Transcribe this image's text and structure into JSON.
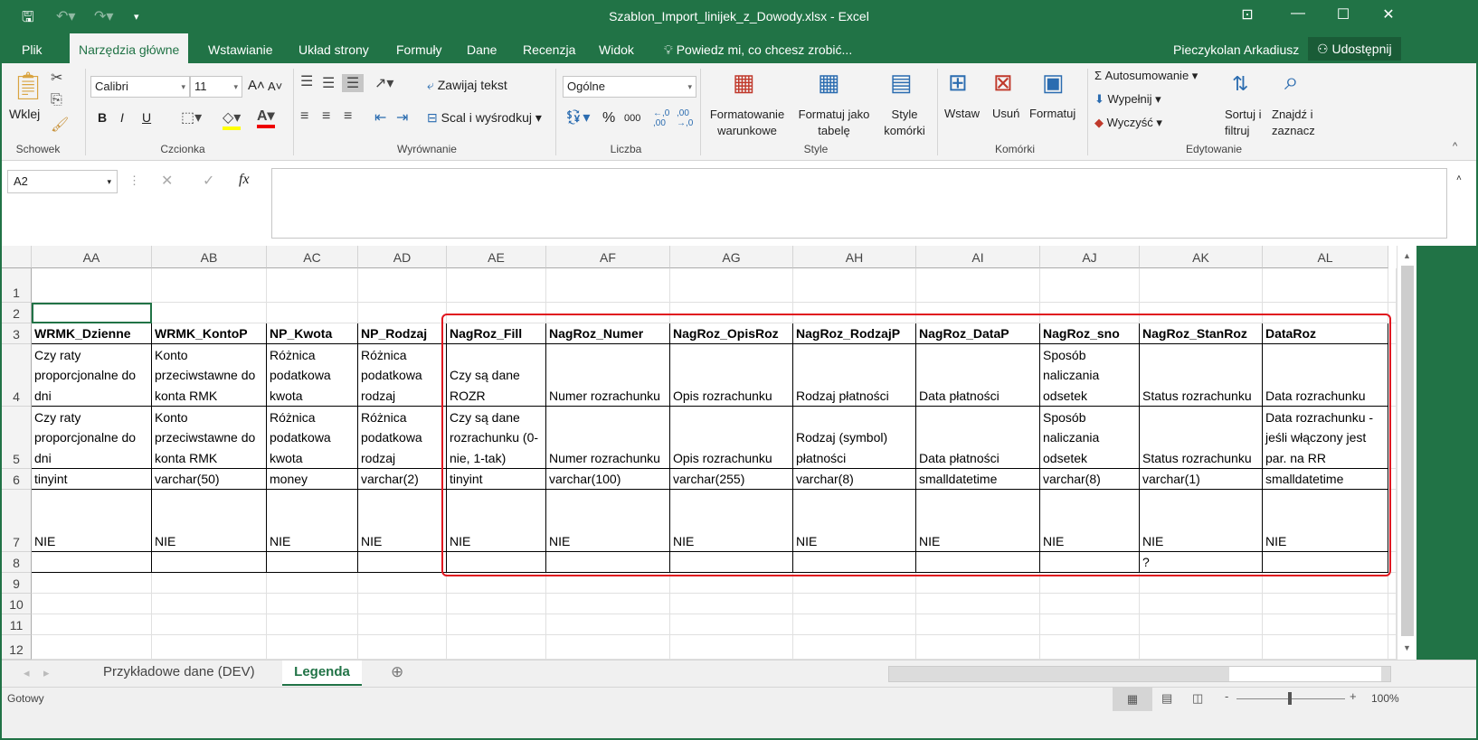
{
  "window": {
    "title": "Szablon_Import_linijek_z_Dowody.xlsx - Excel",
    "user": "Pieczykolan Arkadiusz",
    "share": "Udostępnij"
  },
  "tabs": [
    "Plik",
    "Narzędzia główne",
    "Wstawianie",
    "Układ strony",
    "Formuły",
    "Dane",
    "Recenzja",
    "Widok"
  ],
  "tell_me": "Powiedz mi, co chcesz zrobić...",
  "ribbon": {
    "clipboard": {
      "paste": "Wklej",
      "label": "Schowek"
    },
    "font": {
      "name": "Calibri",
      "size": "11",
      "bold": "B",
      "italic": "I",
      "underline": "U",
      "label": "Czcionka"
    },
    "alignment": {
      "wrap": "Zawijaj tekst",
      "merge": "Scal i wyśrodkuj",
      "label": "Wyrównanie"
    },
    "number": {
      "format": "Ogólne",
      "percent": "%",
      "thousands": "000",
      "label": "Liczba"
    },
    "styles": {
      "conditional": "Formatowanie\nwarunkowe",
      "table": "Formatuj jako\ntabelę",
      "cell": "Style\nkomórki",
      "label": "Style"
    },
    "cells": {
      "insert": "Wstaw",
      "delete": "Usuń",
      "format": "Formatuj",
      "label": "Komórki"
    },
    "editing": {
      "autosum": "Autosumowanie",
      "fill": "Wypełnij",
      "clear": "Wyczyść",
      "sort": "Sortuj i\nfiltruj",
      "find": "Znajdź i\nzaznacz",
      "label": "Edytowanie"
    }
  },
  "formula_bar": {
    "name_box": "A2",
    "fx": "fx",
    "value": ""
  },
  "columns": [
    "AA",
    "AB",
    "AC",
    "AD",
    "AE",
    "AF",
    "AG",
    "AH",
    "AI",
    "AJ",
    "AK",
    "AL"
  ],
  "rows": [
    "1",
    "2",
    "3",
    "4",
    "5",
    "6",
    "7",
    "8",
    "9",
    "10",
    "11",
    "12"
  ],
  "cells": {
    "3": [
      "WRMK_Dzienne",
      "WRMK_KontoP",
      "NP_Kwota",
      "NP_Rodzaj",
      "NagRoz_Fill",
      "NagRoz_Numer",
      "NagRoz_OpisRoz",
      "NagRoz_RodzajP",
      "NagRoz_DataP",
      "NagRoz_sno",
      "NagRoz_StanRoz",
      "DataRoz"
    ],
    "4": [
      "Czy raty proporcjonalne do dni",
      "Konto przeciwstawne do konta RMK",
      "Różnica podatkowa kwota",
      "Różnica podatkowa rodzaj",
      "Czy są dane ROZR",
      "Numer rozrachunku",
      "Opis rozrachunku",
      "Rodzaj płatności",
      "Data płatności",
      "Sposób naliczania odsetek",
      "Status rozrachunku",
      "Data rozrachunku"
    ],
    "5": [
      "Czy raty proporcjonalne do dni",
      "Konto przeciwstawne do konta RMK",
      "Różnica podatkowa kwota",
      "Różnica podatkowa rodzaj",
      "Czy są dane rozrachunku (0-nie, 1-tak)",
      "Numer rozrachunku",
      "Opis rozrachunku",
      "Rodzaj (symbol) płatności",
      "Data płatności",
      "Sposób naliczania odsetek",
      "Status rozrachunku",
      "Data rozrachunku - jeśli włączony jest par. na RR"
    ],
    "6": [
      "tinyint",
      "varchar(50)",
      "money",
      "varchar(2)",
      "tinyint",
      "varchar(100)",
      "varchar(255)",
      "varchar(8)",
      "smalldatetime",
      "varchar(8)",
      "varchar(1)",
      "smalldatetime"
    ],
    "7": [
      "NIE",
      "NIE",
      "NIE",
      "NIE",
      "NIE",
      "NIE",
      "NIE",
      "NIE",
      "NIE",
      "NIE",
      "NIE",
      "NIE"
    ],
    "8": [
      "",
      "",
      "",
      "",
      "",
      "",
      "",
      "",
      "",
      "",
      "?",
      ""
    ]
  },
  "sheets": [
    "Przykładowe dane (DEV)",
    "Legenda"
  ],
  "status": {
    "text": "Gotowy",
    "zoom": "100%"
  }
}
